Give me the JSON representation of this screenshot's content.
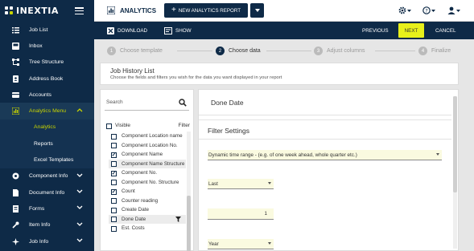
{
  "brand": {
    "name": "INEXTIA"
  },
  "sidebar": {
    "items": [
      {
        "label": "Job List",
        "icon": "list-icon"
      },
      {
        "label": "Inbox",
        "icon": "inbox-icon"
      },
      {
        "label": "Tree Structure",
        "icon": "tree-icon"
      },
      {
        "label": "Address Book",
        "icon": "address-book-icon"
      },
      {
        "label": "Accounts",
        "icon": "accounts-icon"
      },
      {
        "label": "Analytics Menu",
        "icon": "analytics-icon"
      },
      {
        "label": "Analytics"
      },
      {
        "label": "Reports"
      },
      {
        "label": "Excel Templates"
      },
      {
        "label": "Component Info",
        "icon": "component-icon"
      },
      {
        "label": "Document Info",
        "icon": "document-icon"
      },
      {
        "label": "Forms",
        "icon": "forms-icon"
      },
      {
        "label": "Item Info",
        "icon": "item-icon"
      },
      {
        "label": "Job Info",
        "icon": "job-icon"
      }
    ]
  },
  "topbar": {
    "title": "ANALYTICS",
    "new_button": "NEW ANALYTICS REPORT"
  },
  "actionbar": {
    "download": "DOWNLOAD",
    "show": "SHOW",
    "previous": "PREVIOUS",
    "next": "NEXT",
    "cancel": "CANCEL"
  },
  "steps": [
    {
      "num": "1",
      "label": "Choose template"
    },
    {
      "num": "2",
      "label": "Choose data"
    },
    {
      "num": "3",
      "label": "Adjust columns"
    },
    {
      "num": "4",
      "label": "Finalize"
    }
  ],
  "report": {
    "title": "Job History List",
    "subtitle": "Choose the fields and filters you wish for the data you want displayed in your report"
  },
  "fields": {
    "search_placeholder": "Search",
    "visible_header": "Visible",
    "filter_header": "Filter",
    "rows": [
      {
        "label": "Component Location name",
        "checked": false
      },
      {
        "label": "Component Location No.",
        "checked": false
      },
      {
        "label": "Component Name",
        "checked": true
      },
      {
        "label": "Component Name Structure",
        "checked": false,
        "shaded": true
      },
      {
        "label": "Component No.",
        "checked": true
      },
      {
        "label": "Component No. Structure",
        "checked": false
      },
      {
        "label": "Count",
        "checked": true
      },
      {
        "label": "Counter reading",
        "checked": false
      },
      {
        "label": "Create Date",
        "checked": false
      },
      {
        "label": "Done Date",
        "checked": false,
        "shaded": true,
        "filter": true
      },
      {
        "label": "Est. Costs",
        "checked": false
      }
    ]
  },
  "detail": {
    "field_title": "Done Date",
    "filter_title": "Filter Settings",
    "range_select": "Dynamic time range - (e.g. of one week ahead, whole quarter etc.)",
    "direction_select": "Last",
    "amount": "1",
    "unit_select": "Year"
  },
  "colors": {
    "sidebar_bg": "#0e2a47",
    "accent": "#c8d400",
    "next_button": "#e8f01a"
  }
}
